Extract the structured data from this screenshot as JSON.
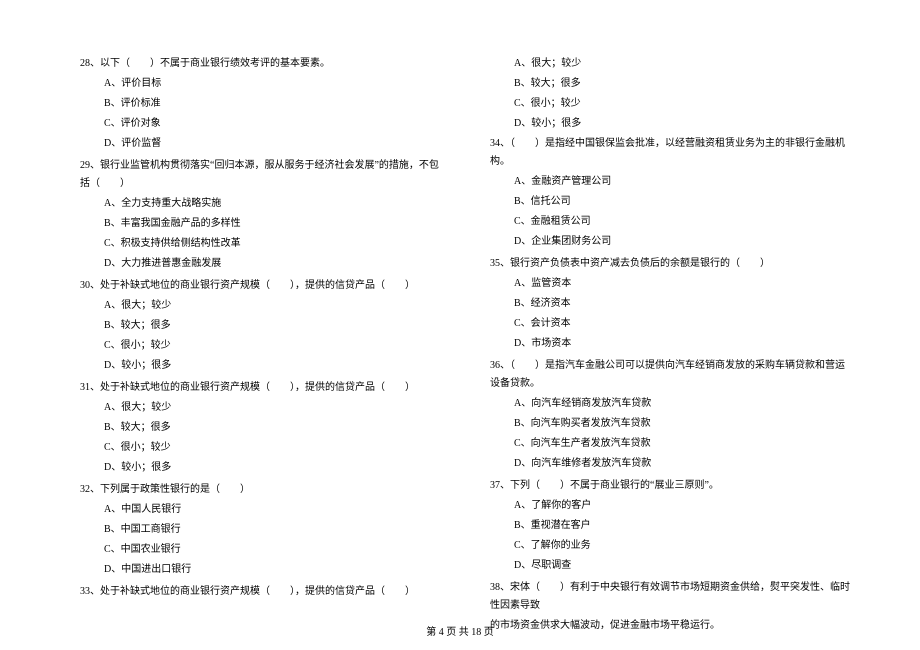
{
  "left_column": {
    "q28": {
      "text": "28、以下（　　）不属于商业银行绩效考评的基本要素。",
      "options": {
        "A": "A、评价目标",
        "B": "B、评价标准",
        "C": "C、评价对象",
        "D": "D、评价监督"
      }
    },
    "q29": {
      "text": "29、银行业监管机构贯彻落实“回归本源，服从服务于经济社会发展”的措施，不包括（　　）",
      "options": {
        "A": "A、全力支持重大战略实施",
        "B": "B、丰富我国金融产品的多样性",
        "C": "C、积极支持供给侧结构性改革",
        "D": "D、大力推进普惠金融发展"
      }
    },
    "q30": {
      "text": "30、处于补缺式地位的商业银行资产规模（　　），提供的信贷产品（　　）",
      "options": {
        "A": "A、很大；较少",
        "B": "B、较大；很多",
        "C": "C、很小；较少",
        "D": "D、较小；很多"
      }
    },
    "q31": {
      "text": "31、处于补缺式地位的商业银行资产规模（　　），提供的信贷产品（　　）",
      "options": {
        "A": "A、很大；较少",
        "B": "B、较大；很多",
        "C": "C、很小；较少",
        "D": "D、较小；很多"
      }
    },
    "q32": {
      "text": "32、下列属于政策性银行的是（　　）",
      "options": {
        "A": "A、中国人民银行",
        "B": "B、中国工商银行",
        "C": "C、中国农业银行",
        "D": "D、中国进出口银行"
      }
    },
    "q33": {
      "text": "33、处于补缺式地位的商业银行资产规模（　　），提供的信贷产品（　　）"
    }
  },
  "right_column": {
    "q33_options": {
      "A": "A、很大；较少",
      "B": "B、较大；很多",
      "C": "C、很小；较少",
      "D": "D、较小；很多"
    },
    "q34": {
      "text": "34、（　　）是指经中国银保监会批准，以经营融资租赁业务为主的非银行金融机构。",
      "options": {
        "A": "A、金融资产管理公司",
        "B": "B、信托公司",
        "C": "C、金融租赁公司",
        "D": "D、企业集团财务公司"
      }
    },
    "q35": {
      "text": "35、银行资产负债表中资产减去负债后的余额是银行的（　　）",
      "options": {
        "A": "A、监管资本",
        "B": "B、经济资本",
        "C": "C、会计资本",
        "D": "D、市场资本"
      }
    },
    "q36": {
      "text": "36、（　　）是指汽车金融公司可以提供向汽车经销商发放的采购车辆贷款和营运设备贷款。",
      "options": {
        "A": "A、向汽车经销商发放汽车贷款",
        "B": "B、向汽车购买者发放汽车贷款",
        "C": "C、向汽车生产者发放汽车贷款",
        "D": "D、向汽车维修者发放汽车贷款"
      }
    },
    "q37": {
      "text": "37、下列（　　）不属于商业银行的“展业三原则”。",
      "options": {
        "A": "A、了解你的客户",
        "B": "B、重视潜在客户",
        "C": "C、了解你的业务",
        "D": "D、尽职调查"
      }
    },
    "q38": {
      "text": "38、宋体（　　）有利于中央银行有效调节市场短期资金供给，熨平突发性、临时性因素导致",
      "text2": "的市场资金供求大幅波动，促进金融市场平稳运行。"
    }
  },
  "footer": "第 4 页 共 18 页"
}
